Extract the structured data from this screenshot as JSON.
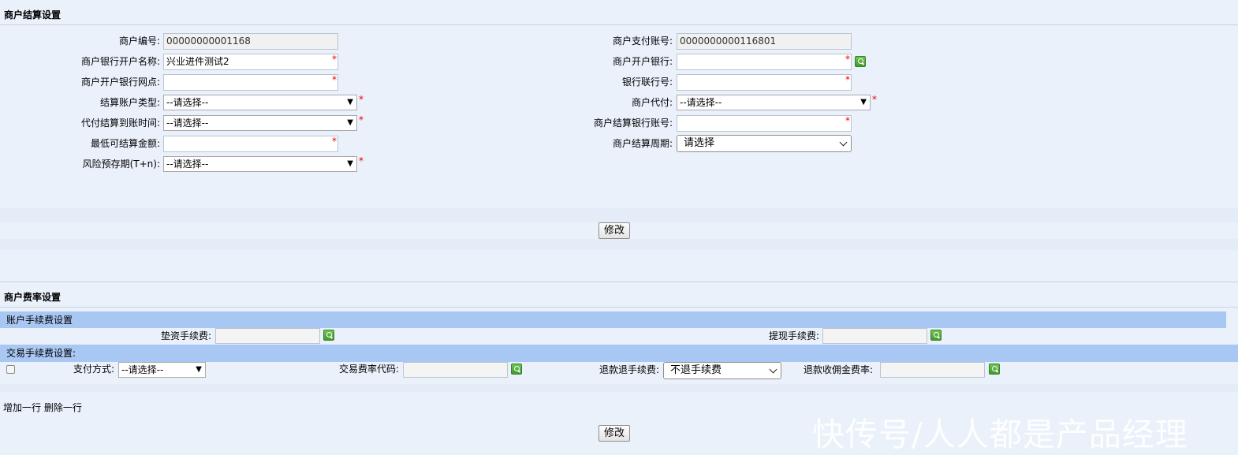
{
  "settlement": {
    "title": "商户结算设置",
    "left": [
      {
        "label": "商户编号:",
        "value": "00000000001168"
      },
      {
        "label": "商户银行开户名称:",
        "value": "兴业进件测试2"
      },
      {
        "label": "商户开户银行网点:",
        "value": ""
      },
      {
        "label": "结算账户类型:",
        "value": "--请选择--"
      },
      {
        "label": "代付结算到账时间:",
        "value": "--请选择--"
      },
      {
        "label": "最低可结算金额:",
        "value": ""
      },
      {
        "label": "风险预存期(T+n):",
        "value": "--请选择--"
      }
    ],
    "right": [
      {
        "label": "商户支付账号:",
        "value": "0000000000116801"
      },
      {
        "label": "商户开户银行:",
        "value": ""
      },
      {
        "label": "银行联行号:",
        "value": ""
      },
      {
        "label": "商户代付:",
        "value": "--请选择--"
      },
      {
        "label": "商户结算银行账号:",
        "value": ""
      },
      {
        "label": "商户结算周期:",
        "value": "请选择"
      }
    ],
    "modify_label": "修改"
  },
  "fee": {
    "title": "商户费率设置",
    "account_bar": "账户手续费设置",
    "advance_fee_label": "垫资手续费:",
    "advance_fee_value": "",
    "withdraw_fee_label": "提现手续费:",
    "withdraw_fee_value": "",
    "trade_bar": "交易手续费设置:",
    "pay_method_label": "支付方式:",
    "pay_method_value": "--请选择--",
    "rate_code_label": "交易费率代码:",
    "rate_code_value": "",
    "refund_fee_label": "退款退手续费:",
    "refund_fee_value": "不退手续费",
    "refund_commission_label": "退款收佣金费率:",
    "refund_commission_value": "",
    "add_row_label": "增加一行",
    "delete_row_label": "删除一行",
    "modify_label": "修改"
  },
  "watermark": "快传号/人人都是产品经理"
}
